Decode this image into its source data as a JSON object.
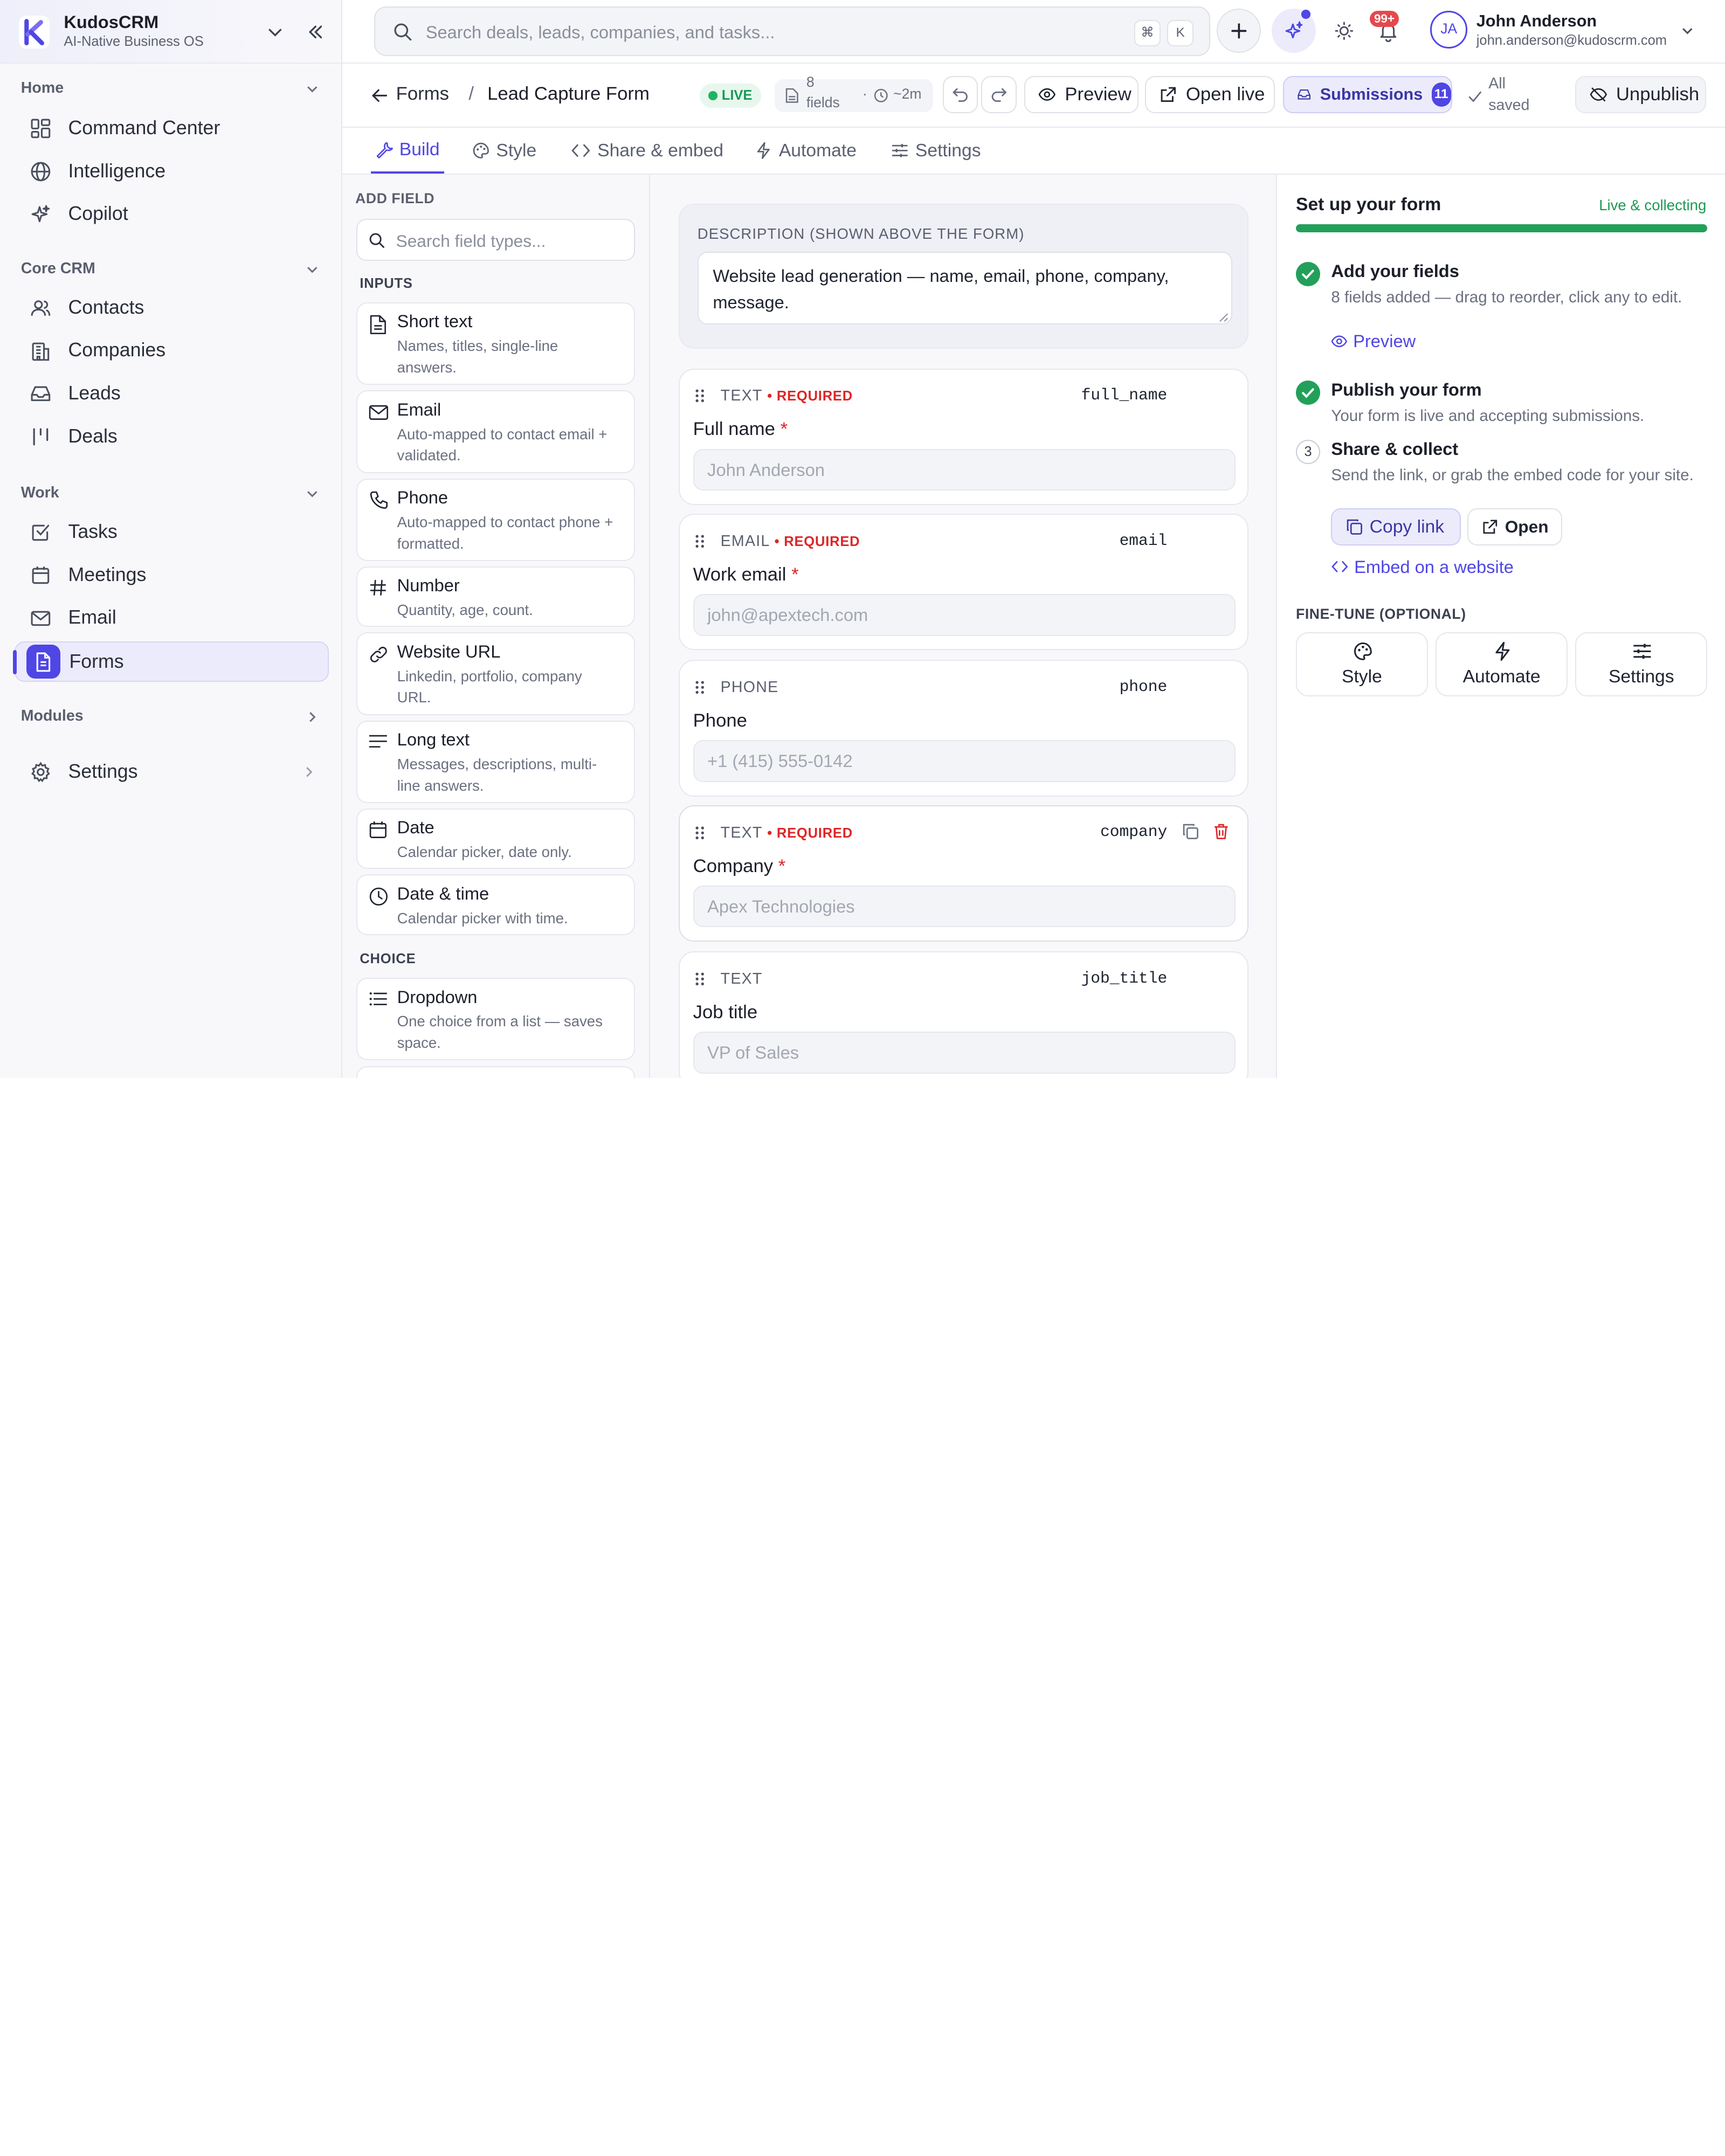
{
  "brand": {
    "name": "KudosCRM",
    "tagline": "AI-Native Business OS"
  },
  "sidebar": {
    "sections": [
      {
        "title": "Home"
      },
      {
        "title": "Core CRM"
      },
      {
        "title": "Work"
      },
      {
        "title": "Modules"
      }
    ],
    "items": [
      {
        "label": "Command Center",
        "icon": "grid-icon"
      },
      {
        "label": "Intelligence",
        "icon": "globe-icon"
      },
      {
        "label": "Copilot",
        "icon": "sparkles-icon"
      },
      {
        "label": "Contacts",
        "icon": "users-icon"
      },
      {
        "label": "Companies",
        "icon": "building-icon"
      },
      {
        "label": "Leads",
        "icon": "inbox-icon"
      },
      {
        "label": "Deals",
        "icon": "bars-icon"
      },
      {
        "label": "Tasks",
        "icon": "check-square-icon"
      },
      {
        "label": "Meetings",
        "icon": "calendar-icon"
      },
      {
        "label": "Email",
        "icon": "mail-icon"
      },
      {
        "label": "Forms",
        "icon": "form-icon",
        "active": true
      },
      {
        "label": "Settings",
        "icon": "gear-icon"
      }
    ]
  },
  "topbar": {
    "search_placeholder": "Search deals, leads, companies, and tasks...",
    "kbd_cmd": "⌘",
    "kbd_k": "K",
    "notifications": "99+",
    "user": {
      "initials": "JA",
      "name": "John Anderson",
      "email": "john.anderson@kudoscrm.com"
    }
  },
  "header": {
    "crumb_parent": "Forms",
    "crumb_sep": "/",
    "crumb_current": "Lead Capture Form",
    "status": "LIVE",
    "fields_count": "8",
    "fields_word": "fields",
    "duration": "~2m",
    "preview": "Preview",
    "open_live": "Open live",
    "submissions": "Submissions",
    "submissions_count": "11",
    "saved_line1": "All",
    "saved_line2": "saved",
    "unpublish": "Unpublish"
  },
  "tabs": [
    {
      "label": "Build",
      "active": true
    },
    {
      "label": "Style"
    },
    {
      "label": "Share & embed"
    },
    {
      "label": "Automate"
    },
    {
      "label": "Settings"
    }
  ],
  "add_field": {
    "title": "ADD FIELD",
    "search_placeholder": "Search field types...",
    "groups": [
      "INPUTS",
      "CHOICE"
    ],
    "types": [
      {
        "title": "Short text",
        "desc": "Names, titles, single-line answers."
      },
      {
        "title": "Email",
        "desc": "Auto-mapped to contact email + validated."
      },
      {
        "title": "Phone",
        "desc": "Auto-mapped to contact phone + formatted."
      },
      {
        "title": "Number",
        "desc": "Quantity, age, count."
      },
      {
        "title": "Website URL",
        "desc": "Linkedin, portfolio, company URL."
      },
      {
        "title": "Long text",
        "desc": "Messages, descriptions, multi-line answers."
      },
      {
        "title": "Date",
        "desc": "Calendar picker, date only."
      },
      {
        "title": "Date & time",
        "desc": "Calendar picker with time."
      },
      {
        "title": "Dropdown",
        "desc": "One choice from a list — saves space."
      }
    ]
  },
  "form": {
    "description_label": "DESCRIPTION (SHOWN ABOVE THE FORM)",
    "description": "Website lead generation — name, email, phone, company, message.",
    "fields": [
      {
        "type": "TEXT",
        "required": "• REQUIRED",
        "key": "full_name",
        "label": "Full name",
        "asterisk": "*",
        "placeholder": "John Anderson"
      },
      {
        "type": "EMAIL",
        "required": "• REQUIRED",
        "key": "email",
        "label": "Work email",
        "asterisk": "*",
        "placeholder": "john@apextech.com"
      },
      {
        "type": "PHONE",
        "required": "",
        "key": "phone",
        "label": "Phone",
        "asterisk": "",
        "placeholder": "+1 (415) 555-0142"
      },
      {
        "type": "TEXT",
        "required": "• REQUIRED",
        "key": "company",
        "label": "Company",
        "asterisk": "*",
        "placeholder": "Apex Technologies"
      },
      {
        "type": "TEXT",
        "required": "",
        "key": "job_title",
        "label": "Job title",
        "asterisk": "",
        "placeholder": "VP of Sales"
      }
    ]
  },
  "setup": {
    "title": "Set up your form",
    "status": "Live & collecting",
    "progress": 1.0,
    "steps": [
      {
        "title": "Add your fields",
        "desc": "8 fields added — drag to reorder, click any to edit.",
        "done": true
      },
      {
        "title": "Publish your form",
        "desc": "Your form is live and accepting submissions.",
        "done": true
      },
      {
        "title": "Share & collect",
        "desc": "Send the link, or grab the embed code for your site.",
        "number": "3"
      }
    ],
    "preview_link": "Preview",
    "copy_link": "Copy link",
    "open": "Open",
    "embed": "Embed on a website",
    "finetune_title": "FINE-TUNE (OPTIONAL)",
    "tiles": [
      "Style",
      "Automate",
      "Settings"
    ]
  }
}
